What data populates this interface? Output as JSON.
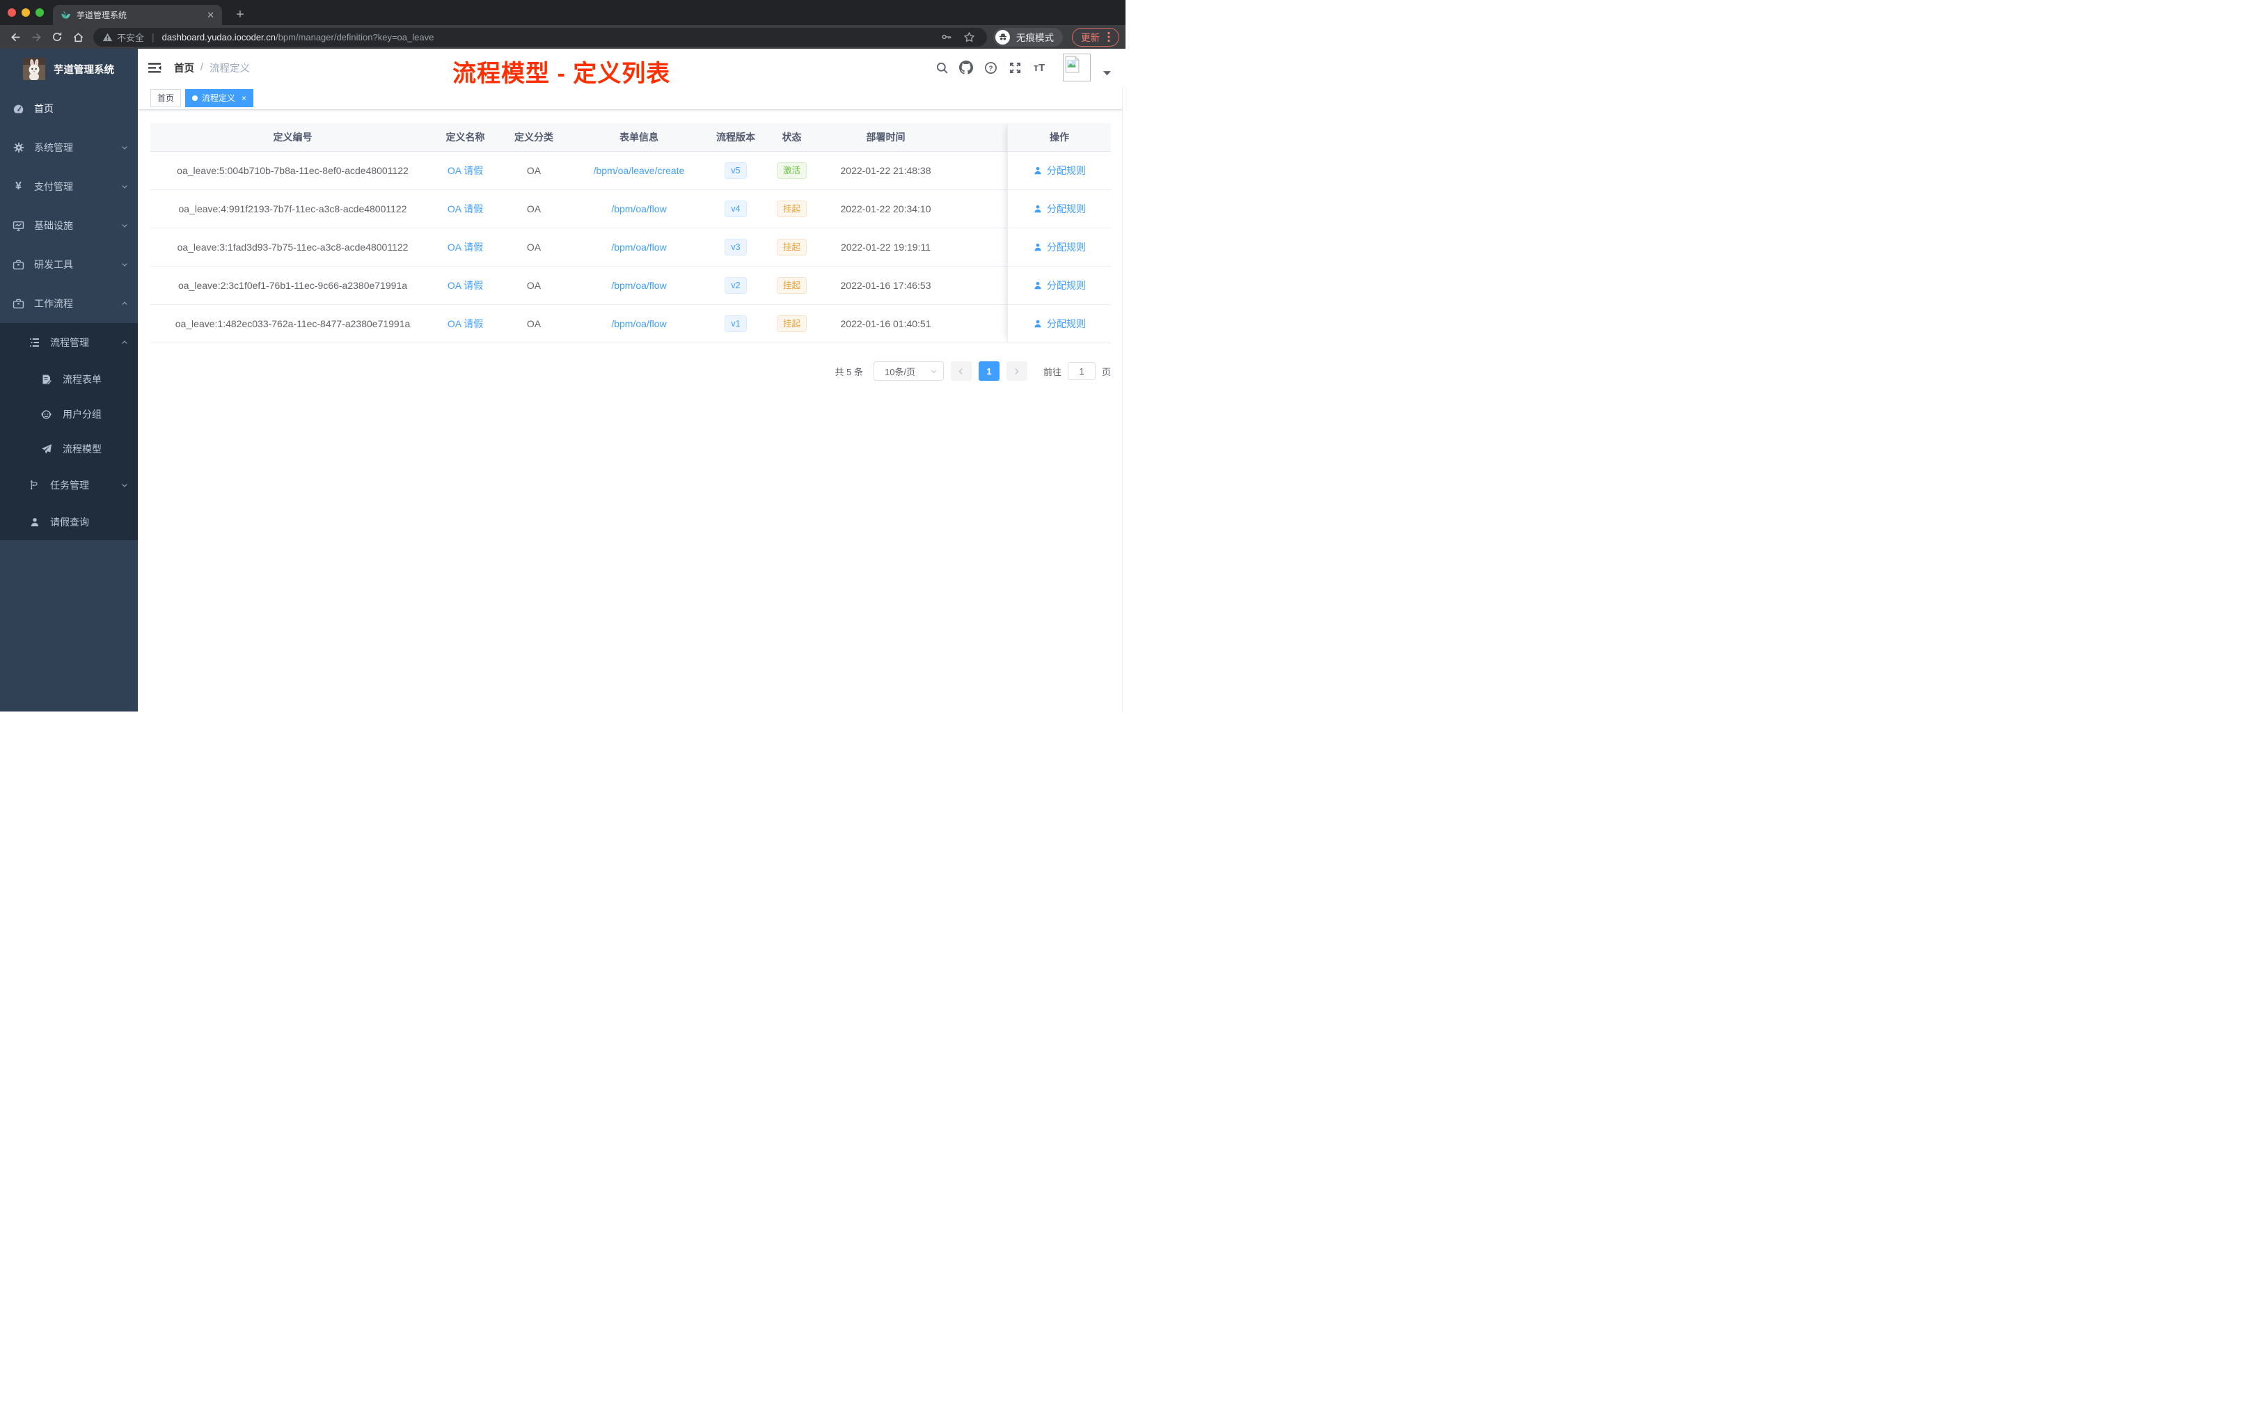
{
  "browser": {
    "tab_title": "芋道管理系统",
    "security_label": "不安全",
    "url_host": "dashboard.yudao.iocoder.cn",
    "url_path": "/bpm/manager/definition?key=oa_leave",
    "incognito_label": "无痕模式",
    "update_label": "更新"
  },
  "sidebar": {
    "app_title": "芋道管理系统",
    "items": [
      {
        "label": "首页",
        "icon": "gauge-icon",
        "expandable": false
      },
      {
        "label": "系统管理",
        "icon": "gear-icon",
        "expandable": true
      },
      {
        "label": "支付管理",
        "icon": "yen-icon",
        "expandable": true
      },
      {
        "label": "基础设施",
        "icon": "monitor-icon",
        "expandable": true
      },
      {
        "label": "研发工具",
        "icon": "briefcase-icon",
        "expandable": true
      },
      {
        "label": "工作流程",
        "icon": "briefcase-icon",
        "expandable": true,
        "expanded": true
      }
    ],
    "submenu": {
      "process": {
        "label": "流程管理",
        "icon": "tree-list-icon",
        "expanded": true,
        "children": [
          {
            "label": "流程表单",
            "icon": "form-icon"
          },
          {
            "label": "用户分组",
            "icon": "face-icon"
          },
          {
            "label": "流程模型",
            "icon": "paper-plane-icon"
          }
        ]
      },
      "task": {
        "label": "任务管理",
        "icon": "branch-icon",
        "expandable": true
      },
      "leave": {
        "label": "请假查询",
        "icon": "person-icon"
      }
    }
  },
  "header": {
    "breadcrumb": [
      "首页",
      "流程定义"
    ],
    "separator": "/",
    "annotation": "流程模型 - 定义列表"
  },
  "tags": [
    {
      "label": "首页",
      "active": false
    },
    {
      "label": "流程定义",
      "active": true
    }
  ],
  "table": {
    "columns": [
      "定义编号",
      "定义名称",
      "定义分类",
      "表单信息",
      "流程版本",
      "状态",
      "部署时间",
      "操作"
    ],
    "rows": [
      {
        "id": "oa_leave:5:004b710b-7b8a-11ec-8ef0-acde48001122",
        "name": "OA 请假",
        "category": "OA",
        "form": "/bpm/oa/leave/create",
        "version": "v5",
        "status": "激活",
        "status_type": "success",
        "deployed_at": "2022-01-22 21:48:38",
        "action": "分配规则"
      },
      {
        "id": "oa_leave:4:991f2193-7b7f-11ec-a3c8-acde48001122",
        "name": "OA 请假",
        "category": "OA",
        "form": "/bpm/oa/flow",
        "version": "v4",
        "status": "挂起",
        "status_type": "warning",
        "deployed_at": "2022-01-22 20:34:10",
        "action": "分配规则"
      },
      {
        "id": "oa_leave:3:1fad3d93-7b75-11ec-a3c8-acde48001122",
        "name": "OA 请假",
        "category": "OA",
        "form": "/bpm/oa/flow",
        "version": "v3",
        "status": "挂起",
        "status_type": "warning",
        "deployed_at": "2022-01-22 19:19:11",
        "action": "分配规则"
      },
      {
        "id": "oa_leave:2:3c1f0ef1-76b1-11ec-9c66-a2380e71991a",
        "name": "OA 请假",
        "category": "OA",
        "form": "/bpm/oa/flow",
        "version": "v2",
        "status": "挂起",
        "status_type": "warning",
        "deployed_at": "2022-01-16 17:46:53",
        "action": "分配规则"
      },
      {
        "id": "oa_leave:1:482ec033-762a-11ec-8477-a2380e71991a",
        "name": "OA 请假",
        "category": "OA",
        "form": "/bpm/oa/flow",
        "version": "v1",
        "status": "挂起",
        "status_type": "warning",
        "deployed_at": "2022-01-16 01:40:51",
        "action": "分配规则"
      }
    ]
  },
  "pagination": {
    "total": "共 5 条",
    "page_size": "10条/页",
    "current_page": "1",
    "goto_label": "前往",
    "goto_value": "1",
    "goto_unit": "页"
  },
  "icons": {
    "favicon": "sprout",
    "tab_close": "x",
    "new_tab": "plus",
    "back": "arrow-left",
    "forward": "arrow-right",
    "reload": "refresh",
    "home": "house",
    "security": "warning-triangle",
    "key": "key",
    "bookmark": "star",
    "incognito": "hat-and-glasses",
    "browser_menu": "three-dots-vertical",
    "collapse_sidebar": "indent-lines",
    "search": "magnifier",
    "github": "octocat",
    "docs": "question-circle",
    "fullscreen": "expand-arrows",
    "font_size": "tT",
    "avatar": "broken-image-placeholder",
    "avatar_caret": "triangle-down",
    "assign_rule": "person"
  },
  "colors": {
    "accent_blue": "#409eff",
    "annotation_red": "#ff2f00",
    "status_active_green": "#67c23a",
    "status_suspend_orange": "#e6a23c",
    "sidebar_bg": "#304156",
    "submenu_bg": "#1f2d3d",
    "update_pill_red": "#ee7a70",
    "chrome_dark": "#222327"
  }
}
